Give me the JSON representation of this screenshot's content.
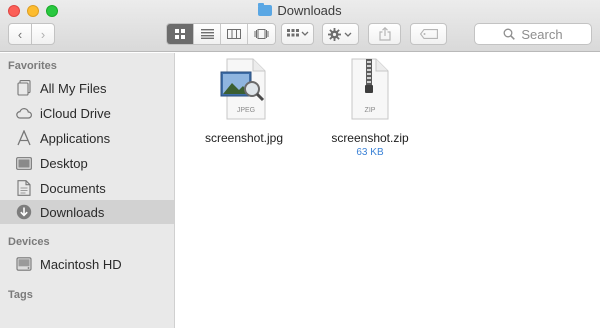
{
  "window": {
    "title": "Downloads"
  },
  "toolbar": {
    "back_icon": "‹",
    "forward_icon": "›",
    "search_placeholder": "Search"
  },
  "sidebar": {
    "favorites_header": "Favorites",
    "favorites": [
      {
        "label": "All My Files",
        "icon": "all-files-icon"
      },
      {
        "label": "iCloud Drive",
        "icon": "cloud-icon"
      },
      {
        "label": "Applications",
        "icon": "applications-icon"
      },
      {
        "label": "Desktop",
        "icon": "desktop-icon"
      },
      {
        "label": "Documents",
        "icon": "documents-icon"
      },
      {
        "label": "Downloads",
        "icon": "downloads-icon",
        "selected": true
      }
    ],
    "devices_header": "Devices",
    "devices": [
      {
        "label": "Macintosh HD",
        "icon": "disk-icon"
      }
    ],
    "tags_header": "Tags"
  },
  "files": [
    {
      "name": "screenshot.jpg",
      "type_label": "JPEG",
      "size": ""
    },
    {
      "name": "screenshot.zip",
      "type_label": "ZIP",
      "size": "63 KB"
    }
  ],
  "colors": {
    "selected_row": "#d2d2d2",
    "size_text": "#3b82d6",
    "folder_blue": "#5aa7e4"
  }
}
